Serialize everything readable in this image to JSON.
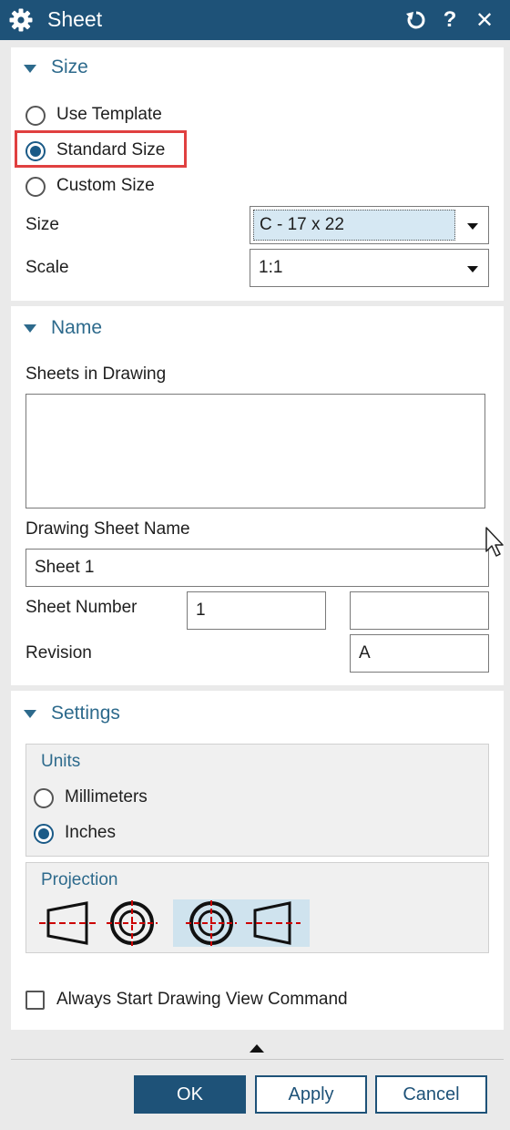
{
  "dialog": {
    "title": "Sheet",
    "icons": [
      "gear-icon",
      "reset-icon",
      "help-icon",
      "close-icon"
    ],
    "help_glyph": "?",
    "close_glyph": "✕"
  },
  "size_section": {
    "title": "Size",
    "options": [
      {
        "label": "Use Template",
        "selected": false
      },
      {
        "label": "Standard Size",
        "selected": true,
        "highlighted": true
      },
      {
        "label": "Custom Size",
        "selected": false
      }
    ],
    "size_label": "Size",
    "size_value": "C - 17 x 22",
    "scale_label": "Scale",
    "scale_value": "1:1"
  },
  "name_section": {
    "title": "Name",
    "sheets_label": "Sheets in Drawing",
    "sheets": [],
    "sheet_name_label": "Drawing Sheet Name",
    "sheet_name_value": "Sheet 1",
    "sheet_number_label": "Sheet Number",
    "sheet_number_value": "1",
    "sheet_number_extra": "",
    "revision_label": "Revision",
    "revision_value": "A"
  },
  "settings_section": {
    "title": "Settings",
    "units_title": "Units",
    "units_options": [
      {
        "label": "Millimeters",
        "selected": false
      },
      {
        "label": "Inches",
        "selected": true
      }
    ],
    "projection_title": "Projection",
    "projection_options": [
      "first-angle",
      "third-angle"
    ],
    "projection_selected": "third-angle",
    "always_start_label": "Always Start Drawing View Command",
    "always_start_checked": false
  },
  "footer": {
    "ok_label": "OK",
    "apply_label": "Apply",
    "cancel_label": "Cancel"
  },
  "colors": {
    "title_bar": "#1e5278",
    "section_title": "#2d6a8c",
    "highlight_box": "#e04040",
    "selected_projection_bg": "#cfe3ee",
    "center_lines": "#cc0000"
  }
}
